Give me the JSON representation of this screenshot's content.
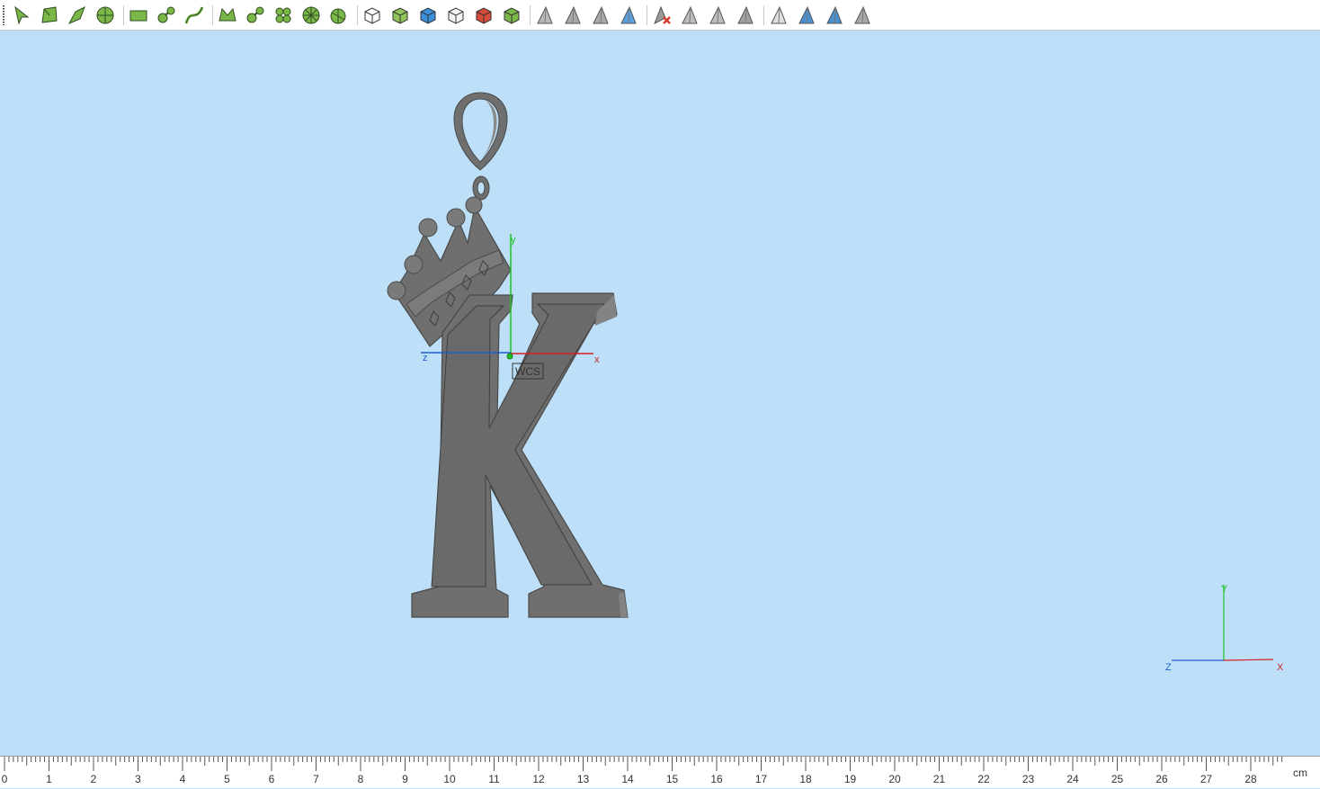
{
  "toolbar": {
    "groups": [
      [
        {
          "name": "select-arrow-icon",
          "kind": "arrow",
          "c": "#7ab648"
        },
        {
          "name": "select-face-icon",
          "kind": "face",
          "c": "#7ab648"
        },
        {
          "name": "select-edge-icon",
          "kind": "edge",
          "c": "#7ab648"
        },
        {
          "name": "select-sphere-icon",
          "kind": "sphere",
          "c": "#7ab648"
        }
      ],
      [
        {
          "name": "rectangle-tool-icon",
          "kind": "rect",
          "c": "#7ab648"
        },
        {
          "name": "node-tool-icon",
          "kind": "nodes",
          "c": "#7ab648"
        },
        {
          "name": "curve-tool-icon",
          "kind": "curve",
          "c": "#7ab648"
        }
      ],
      [
        {
          "name": "surface-tool-icon",
          "kind": "surface",
          "c": "#7ab648"
        },
        {
          "name": "blend-tool-icon",
          "kind": "nodes",
          "c": "#7ab648"
        },
        {
          "name": "clover-tool-icon",
          "kind": "clover",
          "c": "#7ab648"
        },
        {
          "name": "revolve-tool-icon",
          "kind": "wheel",
          "c": "#7ab648"
        },
        {
          "name": "sweep-tool-icon",
          "kind": "wheel2",
          "c": "#7ab648"
        }
      ],
      [
        {
          "name": "box-view-icon",
          "kind": "cube",
          "c": "#ffffff"
        },
        {
          "name": "box-solid-icon",
          "kind": "cube",
          "c": "#8fc25a"
        },
        {
          "name": "box-color-icon",
          "kind": "cube",
          "c": "#3b8fd8"
        },
        {
          "name": "box-wire-icon",
          "kind": "cube",
          "c": "#f4f4f4"
        },
        {
          "name": "box-red-icon",
          "kind": "cube",
          "c": "#d84a3a"
        },
        {
          "name": "box-green-icon",
          "kind": "cube",
          "c": "#7ab648"
        }
      ],
      [
        {
          "name": "pointer-gray-icon",
          "kind": "tri",
          "c": "#b8b8b8"
        },
        {
          "name": "pointer-line-icon",
          "kind": "tri",
          "c": "#a8a8a8"
        },
        {
          "name": "pointer-edge-icon",
          "kind": "tri",
          "c": "#a8a8a8"
        },
        {
          "name": "pointer-blue-icon",
          "kind": "tri",
          "c": "#5aa0e0"
        }
      ],
      [
        {
          "name": "delete-pointer-icon",
          "kind": "tri-x",
          "c": "#d83b2b"
        },
        {
          "name": "triangle-mesh-icon",
          "kind": "tri",
          "c": "#bdbdbd"
        },
        {
          "name": "triangle-copy-icon",
          "kind": "tri",
          "c": "#bdbdbd"
        },
        {
          "name": "triangle-slice-icon",
          "kind": "tri",
          "c": "#a0a0a0"
        }
      ],
      [
        {
          "name": "triangle-eye-icon",
          "kind": "tri",
          "c": "#e0e0e0"
        },
        {
          "name": "triangle-blue-icon",
          "kind": "tri",
          "c": "#4a90d0"
        },
        {
          "name": "triangle-dot-icon",
          "kind": "tri",
          "c": "#4a90d0"
        },
        {
          "name": "triangle-gray-icon",
          "kind": "tri",
          "c": "#a8a8a8"
        }
      ]
    ]
  },
  "viewport": {
    "background": "#bde0f8",
    "model_color": "#6f6f6f",
    "wcs_label": "WCS",
    "local_axes": {
      "x": "x",
      "y": "y",
      "z": "z"
    },
    "corner_axes": {
      "x": "X",
      "y": "Y",
      "z": "Z"
    },
    "axis_colors": {
      "x": "#d42020",
      "y": "#22c022",
      "z": "#1f5fd0"
    }
  },
  "ruler": {
    "labels": [
      "0",
      "1",
      "2",
      "3",
      "4",
      "5",
      "6",
      "7",
      "8",
      "9",
      "10",
      "11",
      "12",
      "13",
      "14",
      "15",
      "16",
      "17",
      "18",
      "19",
      "20",
      "21",
      "22",
      "23",
      "24",
      "25",
      "26",
      "27",
      "28"
    ],
    "unit": "cm"
  }
}
